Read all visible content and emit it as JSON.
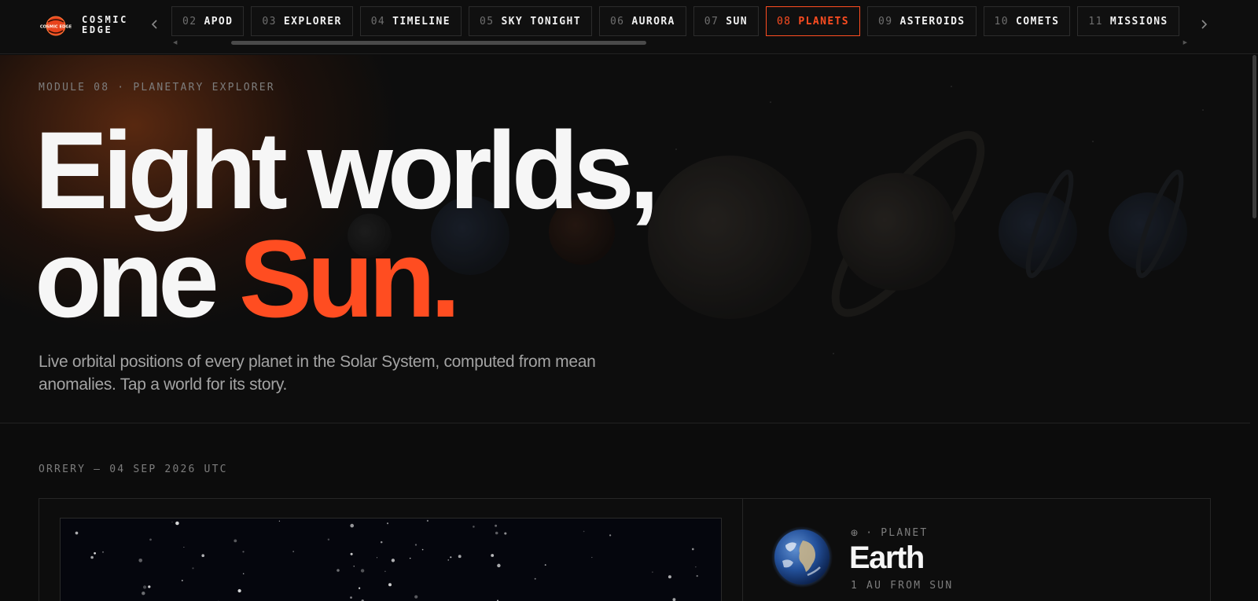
{
  "brand": {
    "line1": "COSMIC",
    "line2": "EDGE",
    "logo_text": "COSMIC EDGE"
  },
  "colors": {
    "accent": "#ff4d21",
    "background": "#0c0c0c",
    "text": "#f6f6f6",
    "muted": "#7d7d7d"
  },
  "nav": {
    "prev_icon": "chevron-left-icon",
    "next_icon": "chevron-right-icon",
    "tabs": [
      {
        "num": "02",
        "label": "APOD",
        "active": false
      },
      {
        "num": "03",
        "label": "EXPLORER",
        "active": false
      },
      {
        "num": "04",
        "label": "TIMELINE",
        "active": false
      },
      {
        "num": "05",
        "label": "SKY TONIGHT",
        "active": false
      },
      {
        "num": "06",
        "label": "AURORA",
        "active": false
      },
      {
        "num": "07",
        "label": "SUN",
        "active": false
      },
      {
        "num": "08",
        "label": "PLANETS",
        "active": true
      },
      {
        "num": "09",
        "label": "ASTEROIDS",
        "active": false
      },
      {
        "num": "10",
        "label": "COMETS",
        "active": false
      },
      {
        "num": "11",
        "label": "MISSIONS",
        "active": false
      }
    ]
  },
  "hero": {
    "eyebrow": "MODULE 08 · PLANETARY EXPLORER",
    "title_line1": "Eight worlds,",
    "title_line2_plain": "one ",
    "title_line2_accent": "Sun.",
    "subtitle": "Live orbital positions of every planet in the Solar System, computed from mean anomalies. Tap a world for its story."
  },
  "orrery": {
    "section_label": "ORRERY — 04 SEP 2026 UTC"
  },
  "planet_card": {
    "symbol": "⊕",
    "kicker": "PLANET",
    "name": "Earth",
    "distance": "1 AU FROM SUN",
    "image_icon": "earth-globe-icon"
  }
}
